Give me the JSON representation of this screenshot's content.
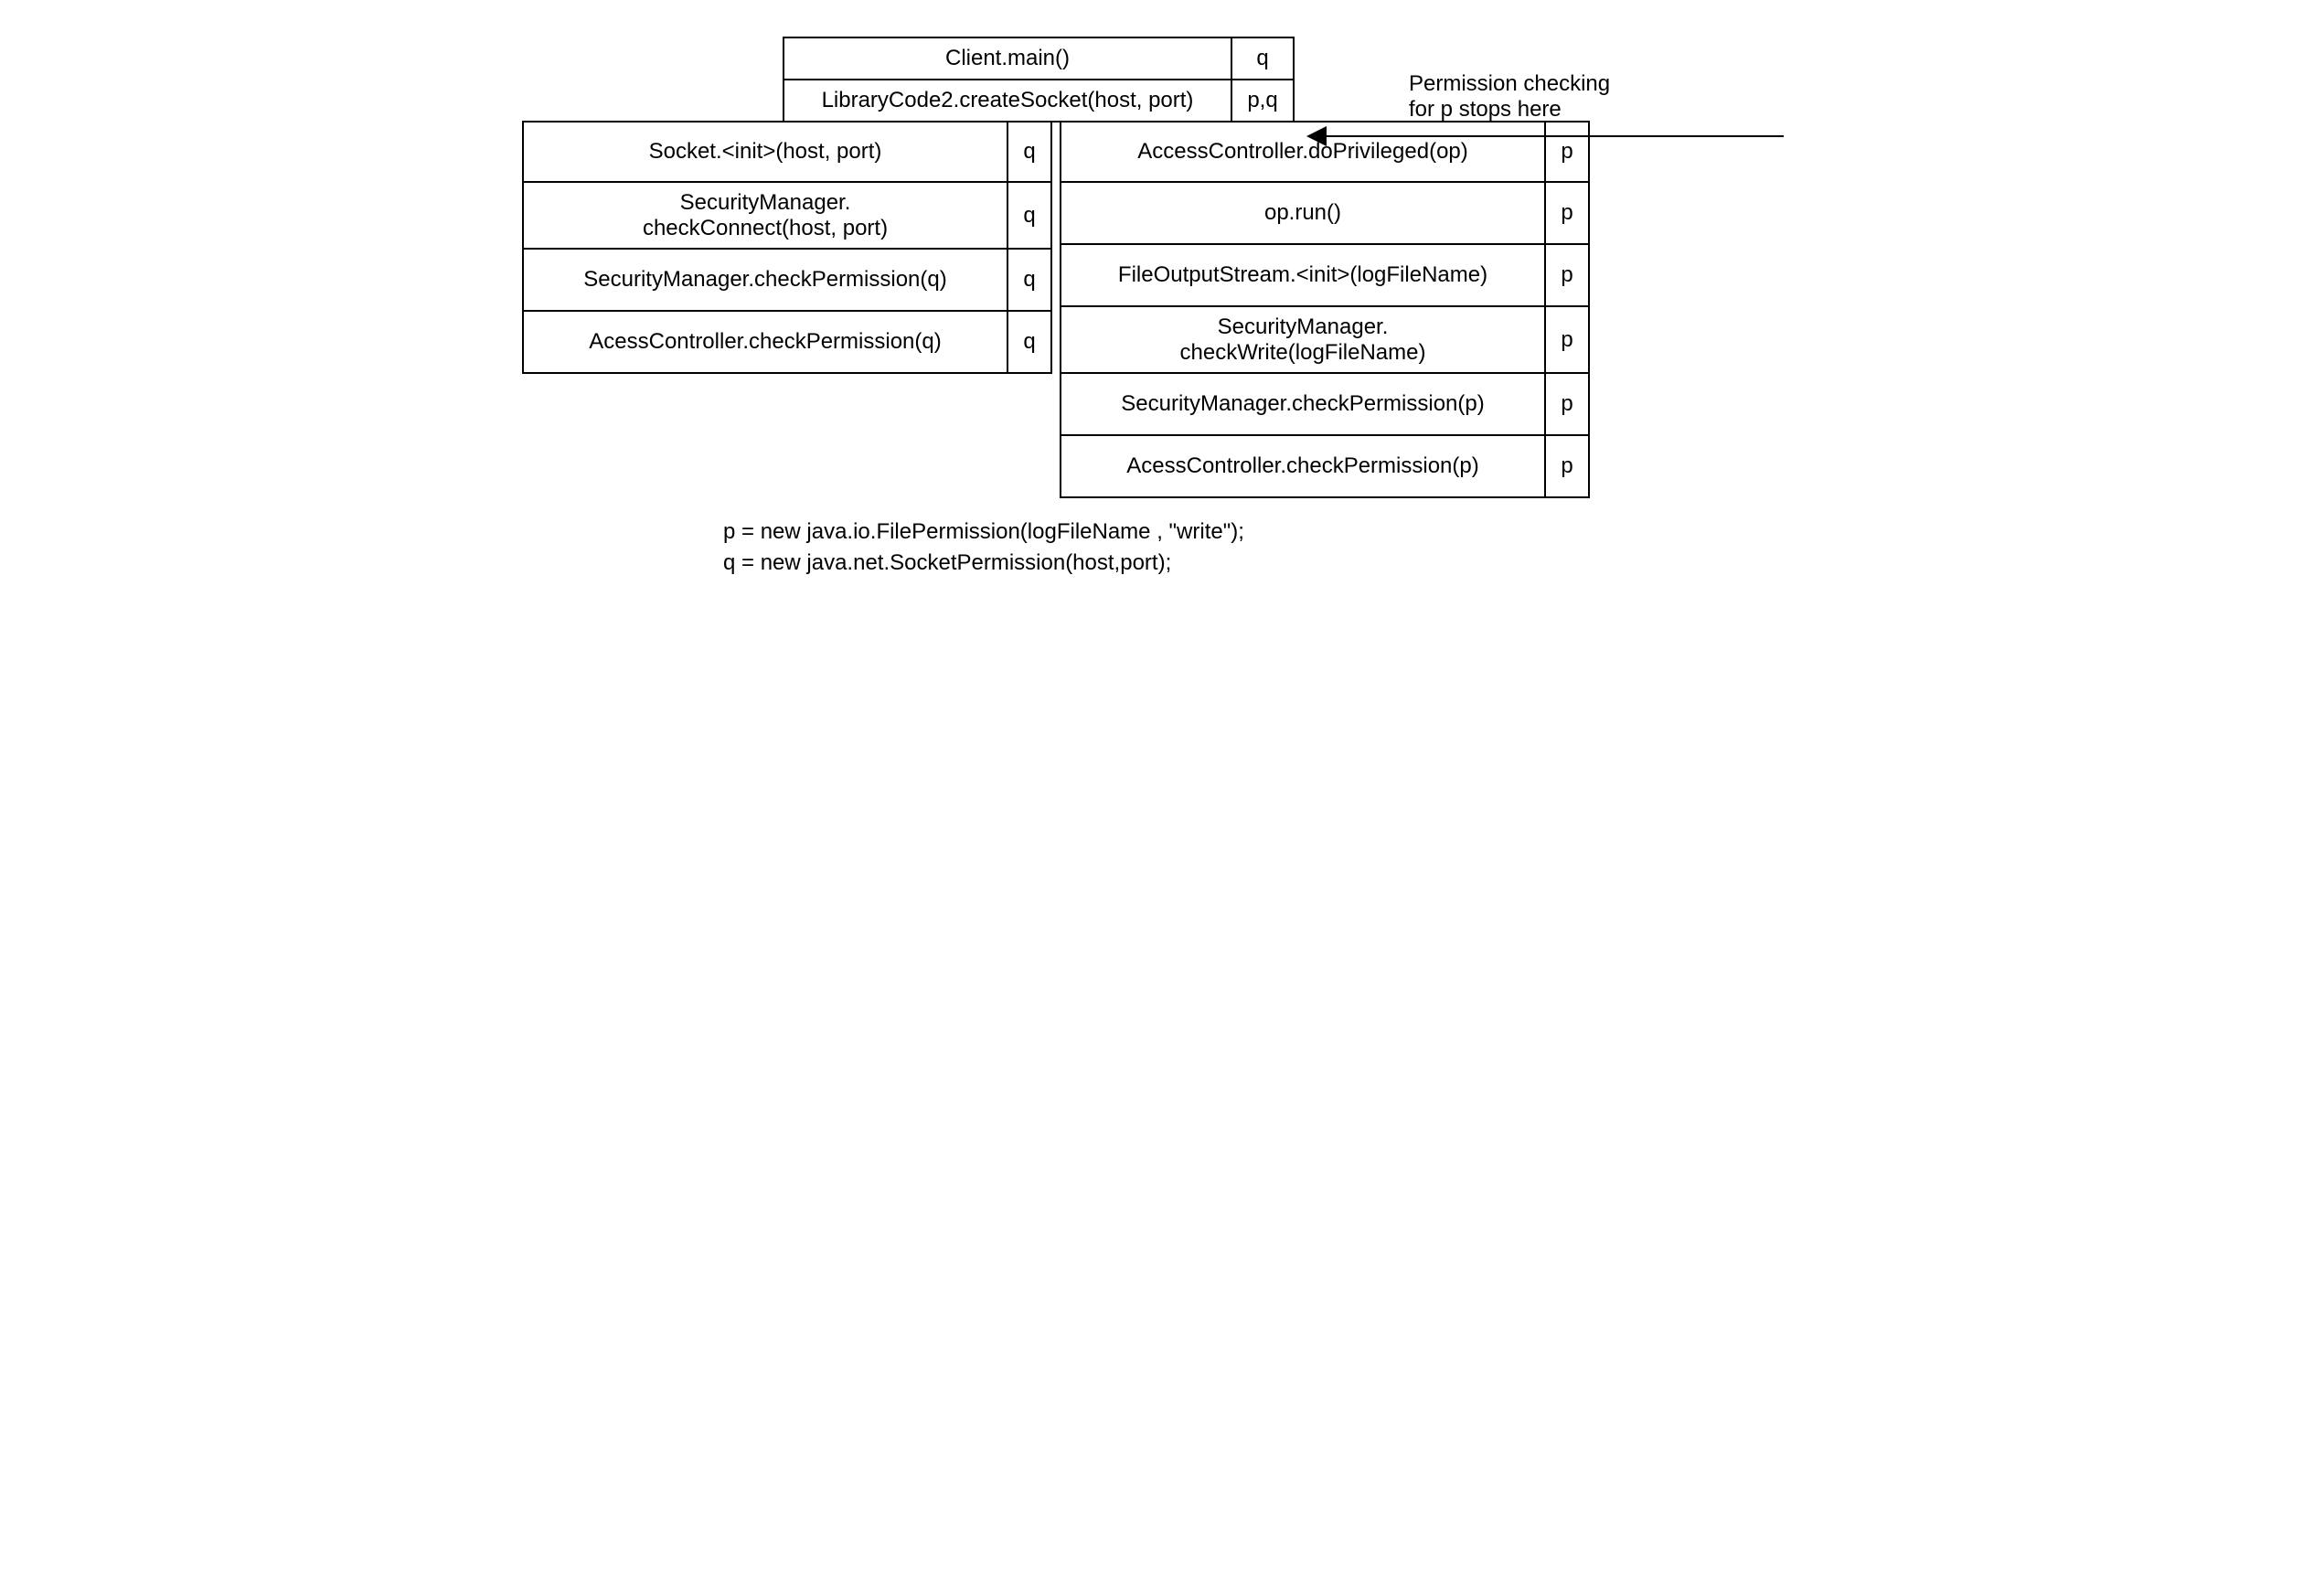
{
  "top": {
    "rows": [
      {
        "label": "Client.main()",
        "perm": "q"
      },
      {
        "label": "LibraryCode2.createSocket(host, port)",
        "perm": "p,q"
      }
    ]
  },
  "left": {
    "rows": [
      {
        "line1": "Socket.<init>(host, port)",
        "line2": "",
        "perm": "q"
      },
      {
        "line1": "SecurityManager.",
        "line2": "checkConnect(host, port)",
        "perm": "q"
      },
      {
        "line1": "SecurityManager.checkPermission(q)",
        "line2": "",
        "perm": "q"
      },
      {
        "line1": "AcessController.checkPermission(q)",
        "line2": "",
        "perm": "q"
      }
    ]
  },
  "right": {
    "rows": [
      {
        "line1": "AccessController.doPrivileged(op)",
        "line2": "",
        "perm": "p"
      },
      {
        "line1": "op.run()",
        "line2": "",
        "perm": "p"
      },
      {
        "line1": "FileOutputStream.<init>(logFileName)",
        "line2": "",
        "perm": "p"
      },
      {
        "line1": "SecurityManager.",
        "line2": "checkWrite(logFileName)",
        "perm": "p"
      },
      {
        "line1": "SecurityManager.checkPermission(p)",
        "line2": "",
        "perm": "p"
      },
      {
        "line1": "AcessController.checkPermission(p)",
        "line2": "",
        "perm": "p"
      }
    ]
  },
  "annotation": {
    "line1": "Permission checking",
    "line2": "for p stops here"
  },
  "legend": {
    "p": "p = new java.io.FilePermission(logFileName , \"write\");",
    "q": "q = new java.net.SocketPermission(host,port);"
  }
}
